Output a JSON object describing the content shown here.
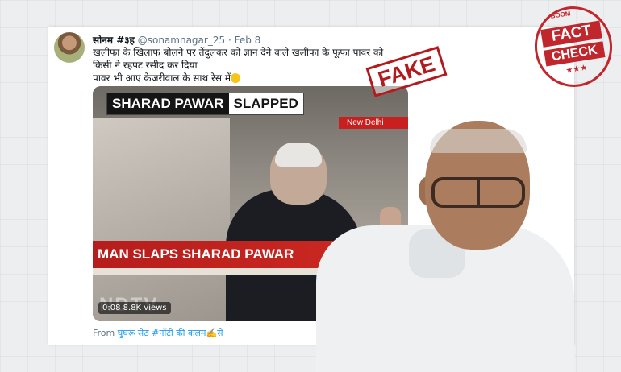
{
  "tweet": {
    "display_name": "सोनम #३ह",
    "handle": "@sonamnagar_25",
    "separator": "·",
    "date": "Feb 8",
    "text_line1": "खलीफा के खिलाफ बोलने पर तेंदुलकर को ज्ञान देने वाले खलीफा के फूफा पावर को",
    "text_line2": "किसी ने रहपट रसीद कर दिया",
    "text_line3": "पावर भी आए केजरीवाल के साथ रेस में",
    "more_icon": "···",
    "from_prefix": "From",
    "from_source": "घुंघरू सेठ #नॉटी की कलम✍️से"
  },
  "video": {
    "headline_left": "SHARAD PAWAR",
    "headline_right": "SLAPPED",
    "location": "New Delhi",
    "lower_third": "MAN SLAPS SHARAD PAWAR",
    "channel_logo": "NDTV",
    "time": "0:08",
    "views": "8.8K views"
  },
  "stamps": {
    "fake": "FAKE",
    "boom": "BOOM",
    "fact_line1": "FACT",
    "fact_line2": "CHECK",
    "stars": "★★★"
  },
  "colors": {
    "stamp_red": "#b21a1d",
    "news_red": "#c8201f",
    "link_blue": "#1d9bf0"
  }
}
